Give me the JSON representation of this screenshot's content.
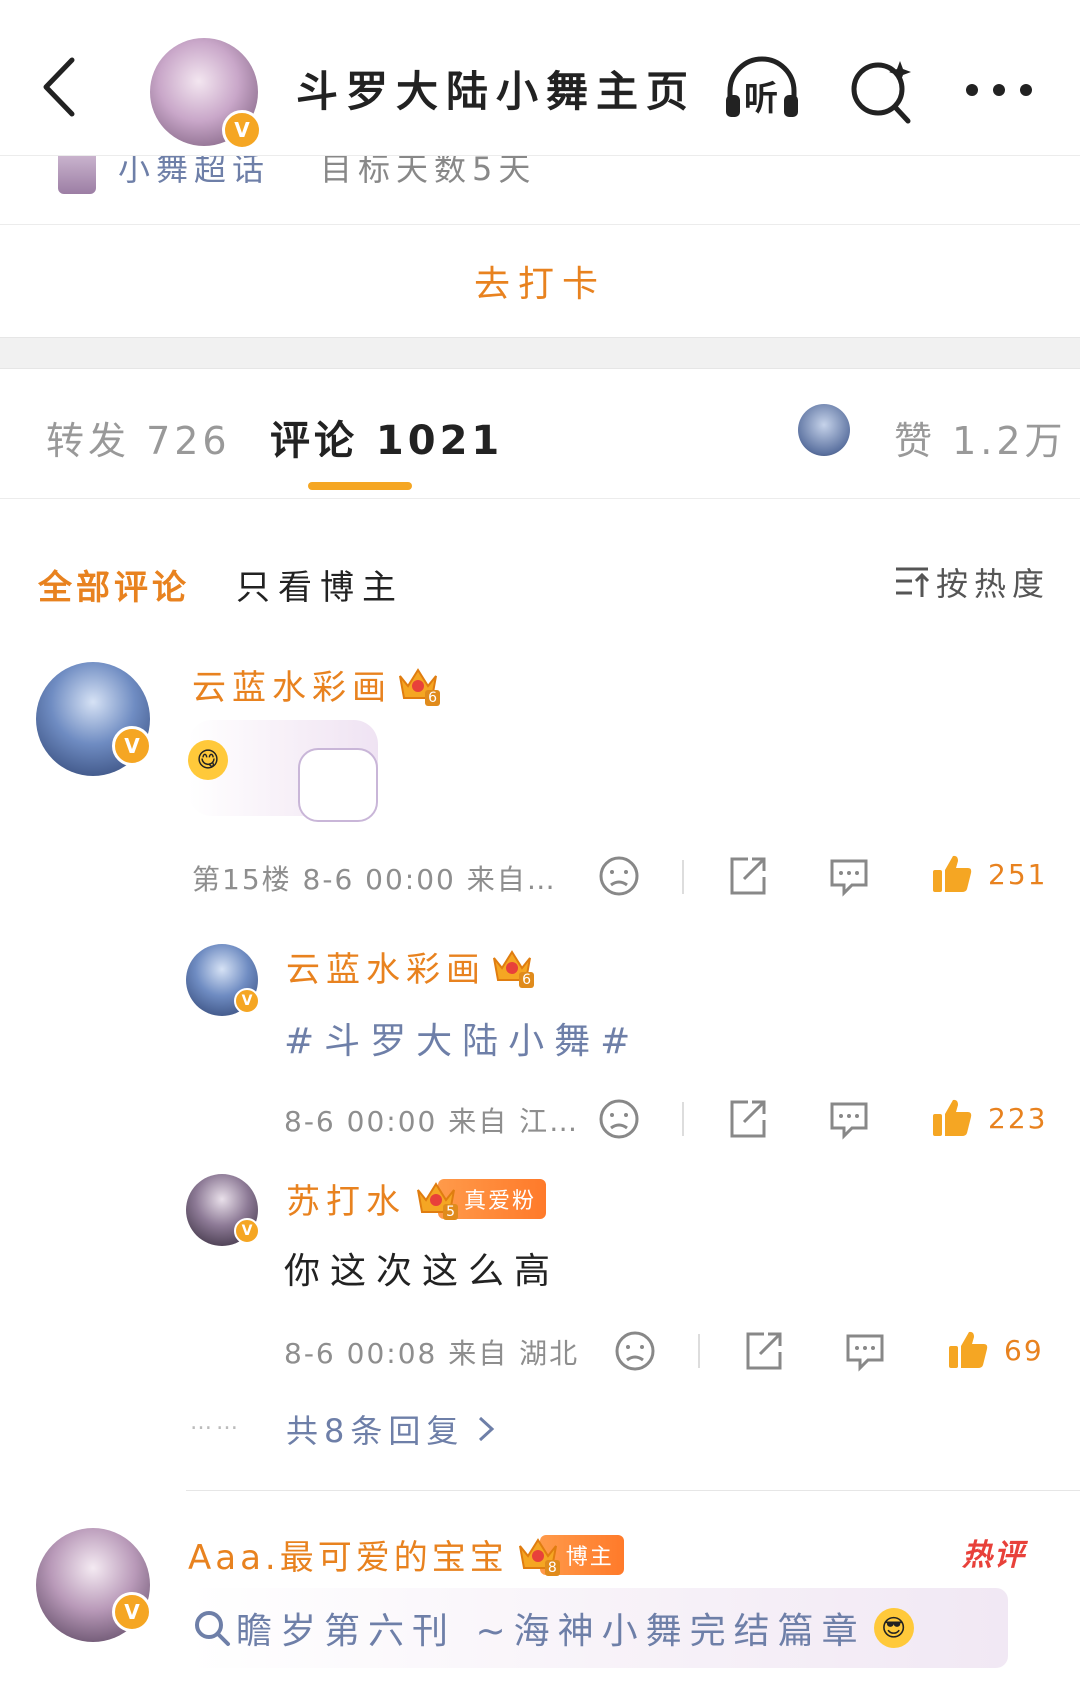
{
  "header": {
    "title": "斗罗大陆小舞主页",
    "listen_label": "听"
  },
  "super_topic": {
    "name": "小舞超话",
    "target": "目标天数5天"
  },
  "checkin": {
    "label": "去打卡"
  },
  "tabs": {
    "repost": "转发 726",
    "comments": "评论 1021",
    "likes": "赞 1.2万"
  },
  "filters": {
    "all": "全部评论",
    "author_only": "只看博主",
    "sort": "按热度"
  },
  "comments": [
    {
      "name": "云蓝水彩画",
      "level": "6",
      "meta": "第15楼 8-6 00:00 来自…",
      "likes": "251",
      "replies": [
        {
          "name": "云蓝水彩画",
          "level": "6",
          "text": "#斗罗大陆小舞#",
          "meta": "8-6 00:00  来自 江…",
          "likes": "223"
        },
        {
          "name": "苏打水",
          "level": "5",
          "tag": "真爱粉",
          "text": "你这次这么高",
          "meta": "8-6 00:08  来自 湖北",
          "likes": "69"
        }
      ],
      "more_replies": "共8条回复",
      "dots": "……"
    },
    {
      "name": "Aaa.最可爱的宝宝",
      "level": "8",
      "tag": "博主",
      "hot": "热评",
      "text": "瞻岁第六刊 ~海神小舞完结篇章"
    }
  ],
  "colors": {
    "accent": "#e8821f",
    "link_blue": "#6e7fa8",
    "hot_red": "#e8413a"
  }
}
